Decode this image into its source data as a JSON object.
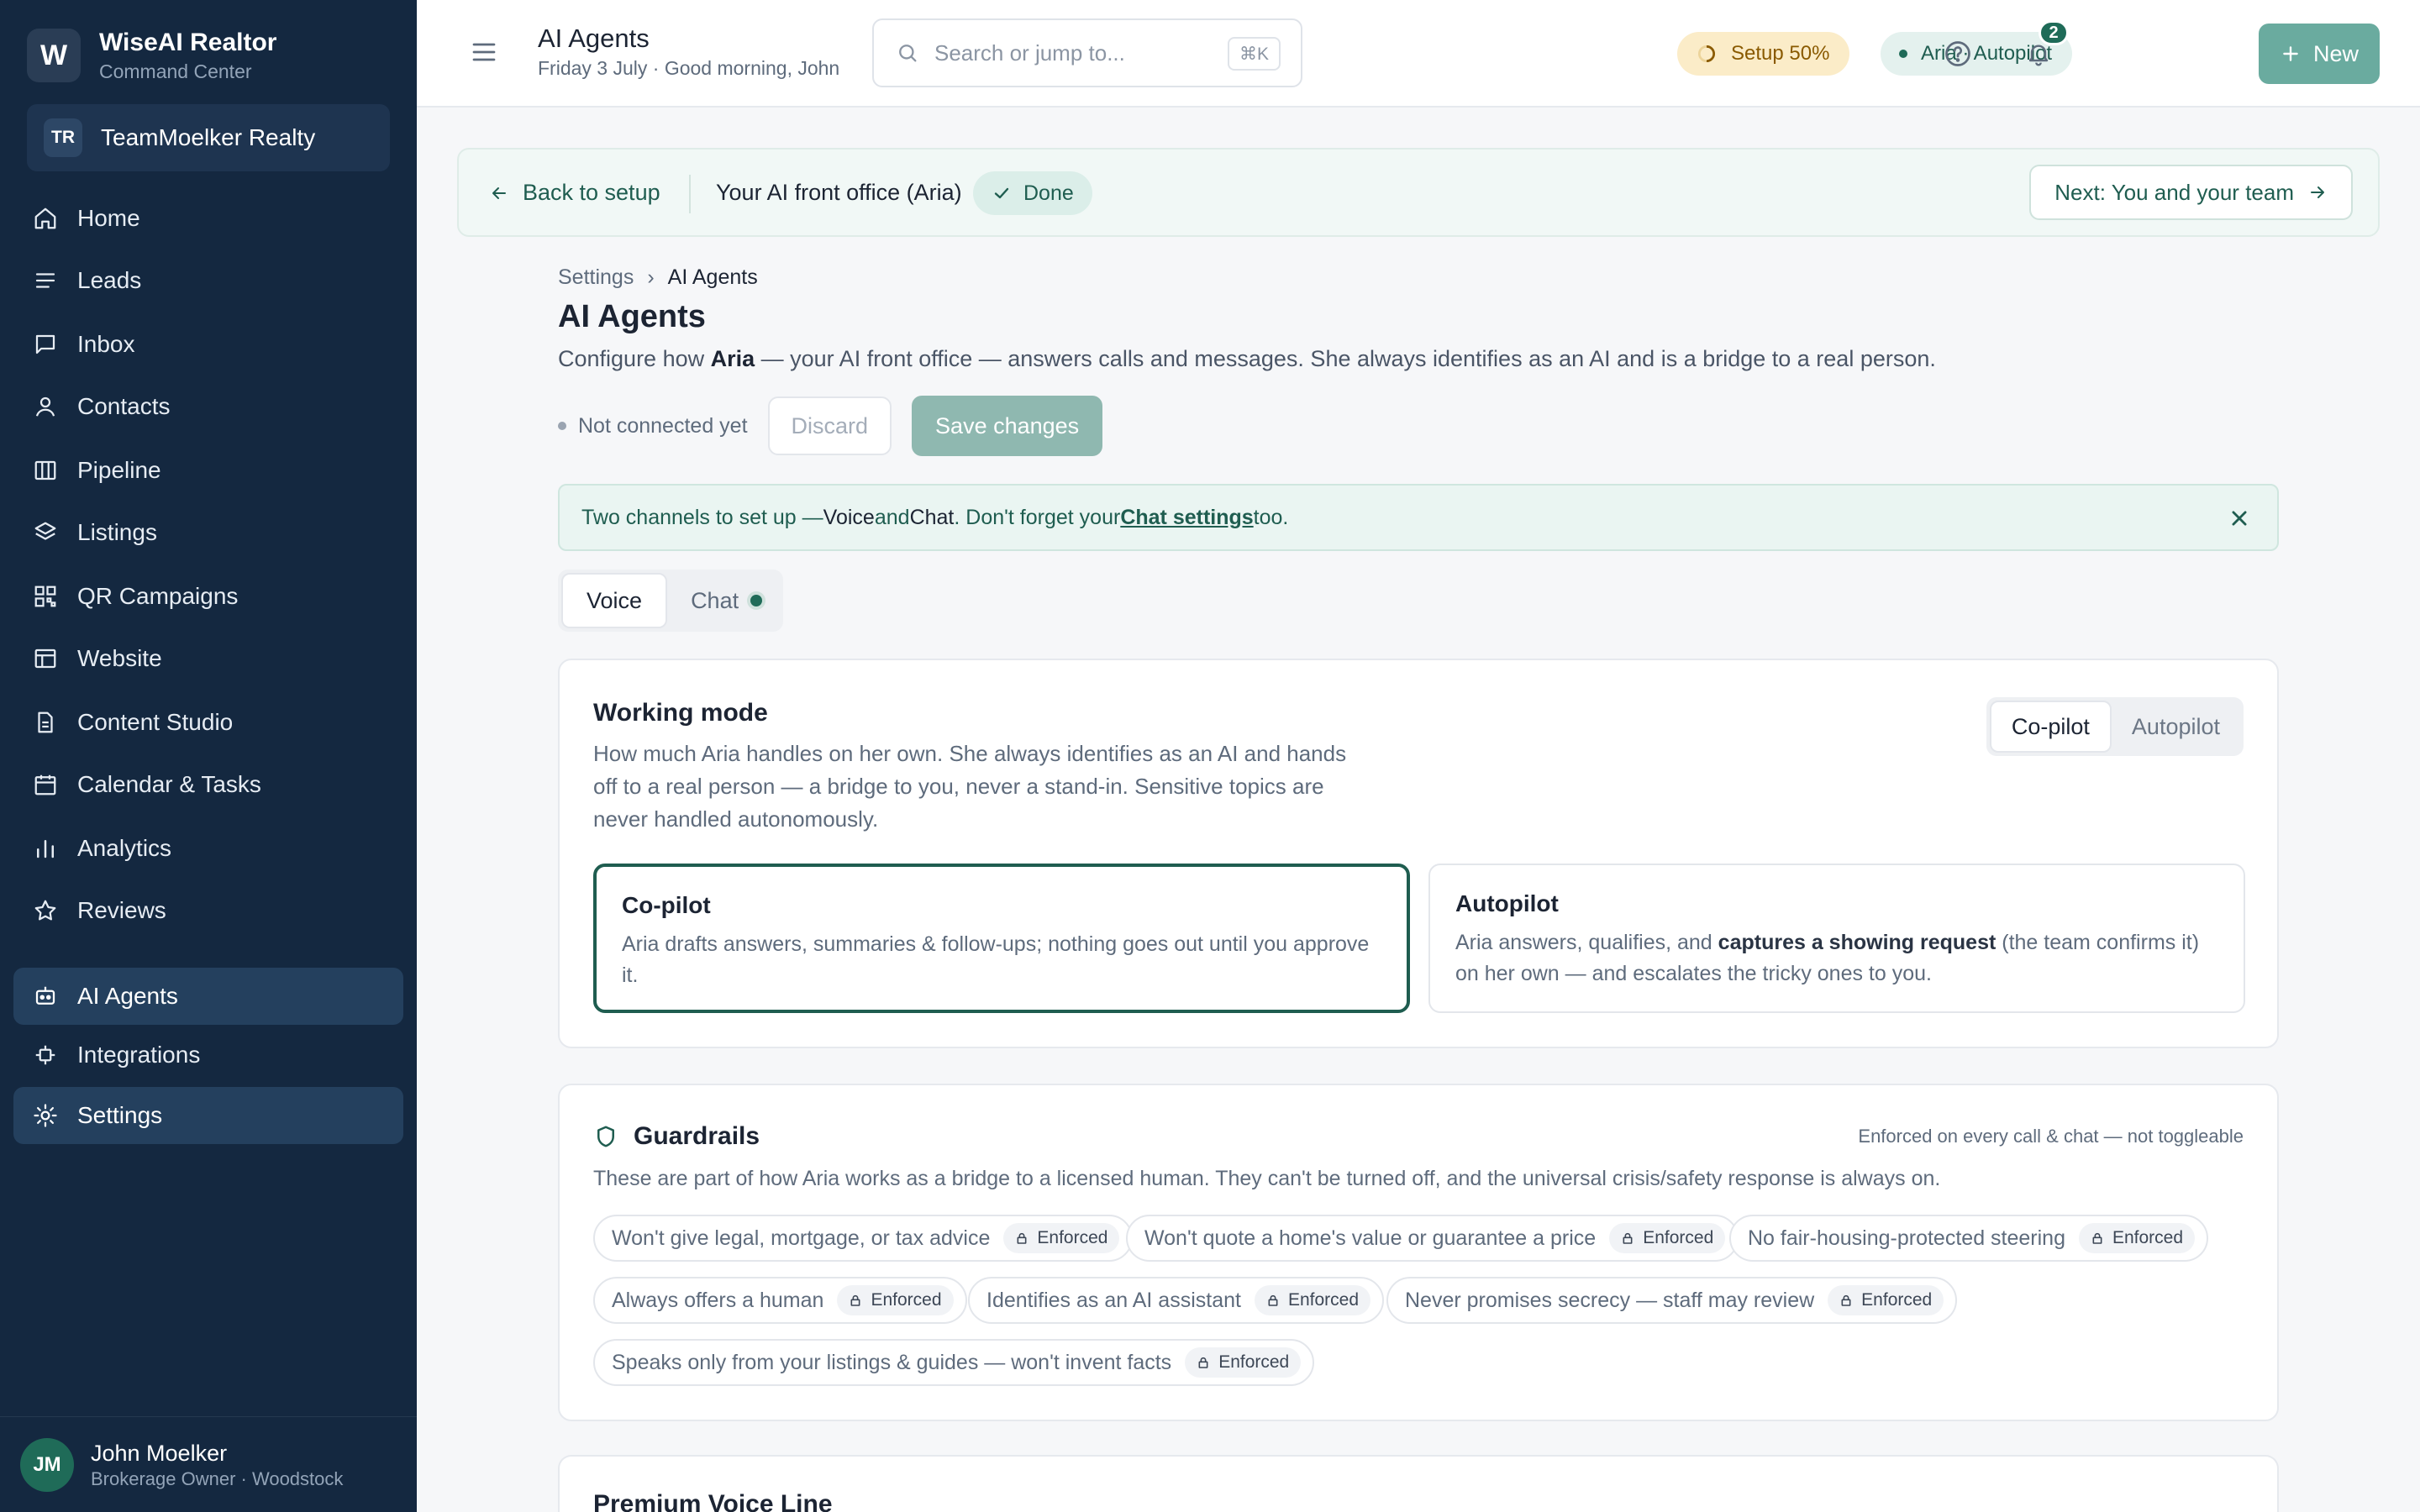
{
  "brand": {
    "logo_letter": "W",
    "name": "WiseAI Realtor",
    "subtitle": "Command Center"
  },
  "team": {
    "initials": "TR",
    "name": "TeamMoelker Realty"
  },
  "nav": {
    "items": [
      {
        "label": "Home",
        "icon": "home-icon"
      },
      {
        "label": "Leads",
        "icon": "list-icon"
      },
      {
        "label": "Inbox",
        "icon": "message-icon"
      },
      {
        "label": "Contacts",
        "icon": "person-icon"
      },
      {
        "label": "Pipeline",
        "icon": "columns-icon"
      },
      {
        "label": "Listings",
        "icon": "layers-icon"
      },
      {
        "label": "QR Campaigns",
        "icon": "qr-icon"
      },
      {
        "label": "Website",
        "icon": "browser-icon"
      },
      {
        "label": "Content Studio",
        "icon": "document-icon"
      },
      {
        "label": "Calendar & Tasks",
        "icon": "calendar-icon"
      },
      {
        "label": "Analytics",
        "icon": "bar-chart-icon"
      },
      {
        "label": "Reviews",
        "icon": "star-icon"
      },
      {
        "label": "AI Agents",
        "icon": "robot-icon"
      },
      {
        "label": "Integrations",
        "icon": "plug-icon"
      },
      {
        "label": "Settings",
        "icon": "gear-icon"
      }
    ],
    "active": "Settings"
  },
  "user": {
    "initials": "JM",
    "name": "John Moelker",
    "role": "Brokerage Owner · Woodstock"
  },
  "topbar": {
    "title": "AI Agents",
    "date": "Friday 3 July · Good morning, John",
    "search_placeholder": "Search or jump to...",
    "search_shortcut": "⌘K",
    "setup_label": "Setup 50%",
    "aria_label": "Aria · Autopilot",
    "notification_count": "2",
    "new_label": "New"
  },
  "setup_strip": {
    "back_label": "Back to setup",
    "title": "Your AI front office (Aria)",
    "done_label": "Done",
    "next_label": "Next: You and your team"
  },
  "breadcrumb": {
    "parent": "Settings",
    "separator": "›",
    "current": "AI Agents"
  },
  "page": {
    "heading": "AI Agents",
    "lead_pre": "Configure how ",
    "lead_name": "Aria",
    "lead_post": " — your AI front office — answers calls and messages. She always identifies as an AI and is a bridge to a real person.",
    "status": "Not connected yet",
    "discard_label": "Discard",
    "save_label": "Save changes"
  },
  "banner": {
    "pre": "Two channels to set up — ",
    "voice": "Voice",
    "and": " and ",
    "chat": "Chat",
    "mid": ". Don't forget your ",
    "link": "Chat settings",
    "post": " too."
  },
  "channel_tabs": [
    {
      "label": "Voice"
    },
    {
      "label": "Chat"
    }
  ],
  "working_mode": {
    "title": "Working mode",
    "description": "How much Aria handles on her own. She always identifies as an AI and hands off to a real person — a bridge to you, never a stand-in. Sensitive topics are never handled autonomously.",
    "toggle": [
      "Co-pilot",
      "Autopilot"
    ],
    "selected": "Co-pilot",
    "options": [
      {
        "title": "Co-pilot",
        "desc": "Aria drafts answers, summaries & follow-ups; nothing goes out until you approve it."
      },
      {
        "title": "Autopilot",
        "desc_pre": "Aria answers, qualifies, and ",
        "desc_bold": "captures a showing request",
        "desc_post": " (the team confirms it) on her own — and escalates the tricky ones to you."
      }
    ]
  },
  "guardrails": {
    "title": "Guardrails",
    "note": "Enforced on every call & chat — not toggleable",
    "description": "These are part of how Aria works as a bridge to a licensed human. They can't be turned off, and the universal crisis/safety response is always on.",
    "enforced_label": "Enforced",
    "items": [
      "Won't give legal, mortgage, or tax advice",
      "Won't quote a home's value or guarantee a price",
      "No fair-housing-protected steering",
      "Always offers a human",
      "Identifies as an AI assistant",
      "Never promises secrecy — staff may review",
      "Speaks only from your listings & guides — won't invent facts"
    ]
  },
  "premium": {
    "title": "Premium Voice Line"
  },
  "colors": {
    "sidebar": "#142840",
    "accent": "#1f6b58",
    "accent_light": "#6aab9f",
    "setup_pill": "#fbecc8"
  }
}
